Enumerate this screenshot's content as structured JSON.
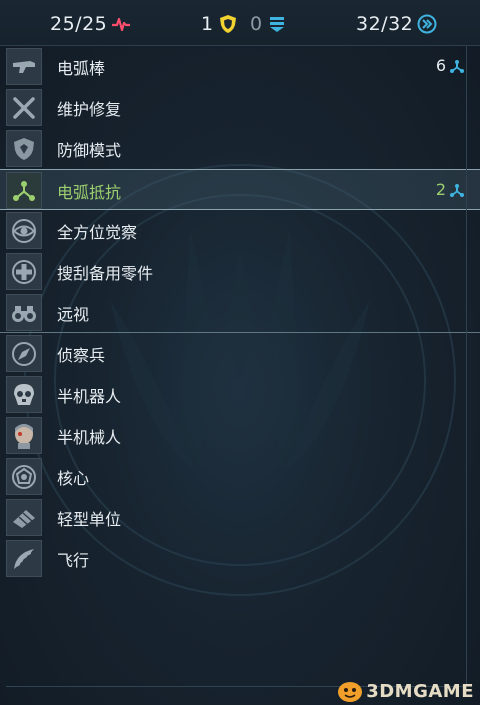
{
  "stats": {
    "health": "25/25",
    "shield": "1",
    "energy": "0",
    "moves": "32/32"
  },
  "items": [
    {
      "label": "电弧棒",
      "count": "6",
      "icon": "arc-rod-icon"
    },
    {
      "label": "维护修复",
      "count": "",
      "icon": "repair-tools-icon"
    },
    {
      "label": "防御模式",
      "count": "",
      "icon": "defense-shield-icon"
    },
    {
      "label": "电弧抵抗",
      "count": "2",
      "icon": "arc-resist-icon"
    },
    {
      "label": "全方位觉察",
      "count": "",
      "icon": "eye-awareness-icon"
    },
    {
      "label": "搜刮备用零件",
      "count": "",
      "icon": "medkit-cross-icon"
    },
    {
      "label": "远视",
      "count": "",
      "icon": "binoculars-icon"
    },
    {
      "label": "侦察兵",
      "count": "",
      "icon": "compass-scout-icon"
    },
    {
      "label": "半机器人",
      "count": "",
      "icon": "cyborg-skull-icon"
    },
    {
      "label": "半机械人",
      "count": "",
      "icon": "cyborg-head-icon"
    },
    {
      "label": "核心",
      "count": "",
      "icon": "core-icon"
    },
    {
      "label": "轻型单位",
      "count": "",
      "icon": "light-unit-icon"
    },
    {
      "label": "飞行",
      "count": "",
      "icon": "wing-flight-icon"
    }
  ],
  "watermark": "3DMGAME",
  "colors": {
    "selected_text": "#9ccf6f",
    "health_accent": "#ff4f6d",
    "shield_accent": "#f2d231",
    "energy_accent": "#3fb4e0",
    "moves_accent": "#3fb4e0"
  }
}
